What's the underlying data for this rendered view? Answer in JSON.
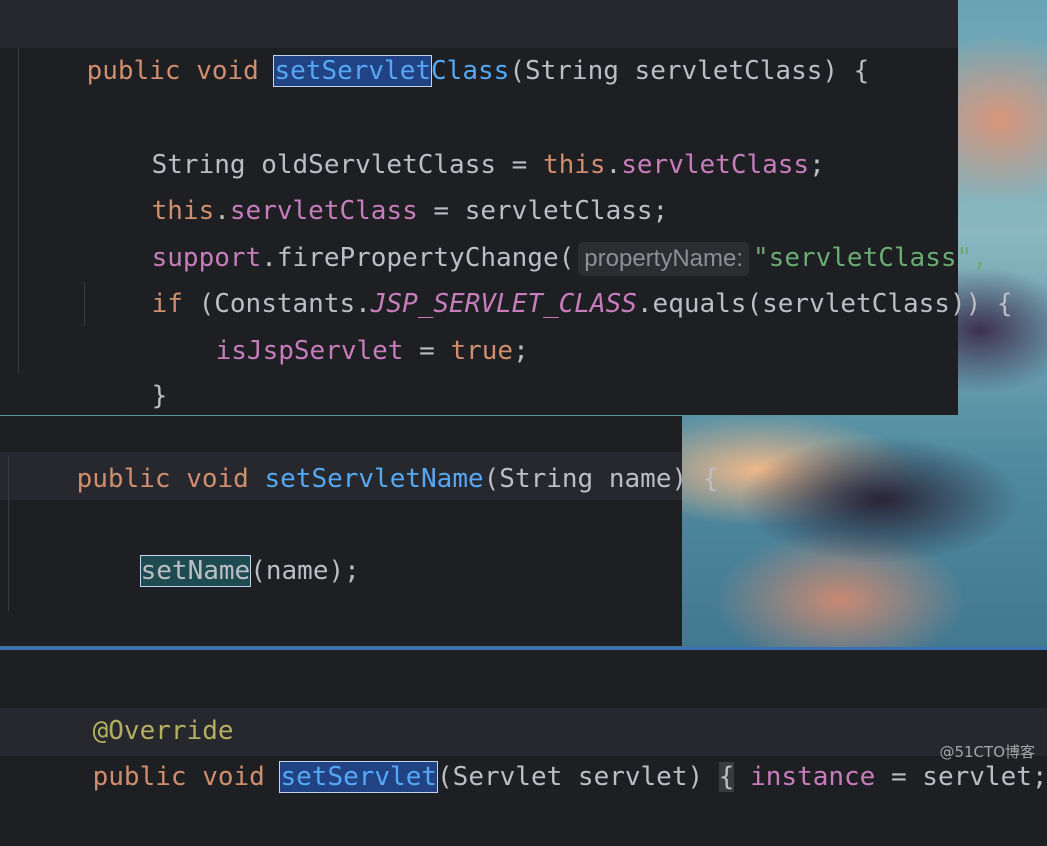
{
  "panel1": {
    "sig": {
      "kw1": "public",
      "kw2": "void",
      "name_sel": "setServlet",
      "name_rest": "Class",
      "params": "(String servletClass) {"
    },
    "l1": {
      "type": "String",
      "rest": " oldServletClass = ",
      "kw_this": "this",
      "dot": ".",
      "field": "servletClass",
      "end": ";"
    },
    "l2": {
      "kw_this": "this",
      "dot": ".",
      "field": "servletClass",
      "rest": " = servletClass;"
    },
    "l3": {
      "field": "support",
      "call": ".firePropertyChange(",
      "hint": "propertyName:",
      "str": "\"servletClass\","
    },
    "l4": {
      "kw_if": "if",
      "a": " (Constants.",
      "const": "JSP_SERVLET_CLASS",
      "b": ".equals(servletClass)) {"
    },
    "l5": {
      "field": "isJspServlet",
      "eq": " = ",
      "kw_true": "true",
      "end": ";"
    },
    "l6": "}",
    "l7": "}"
  },
  "panel2": {
    "sig": {
      "kw1": "public",
      "kw2": "void",
      "name": "setServletName",
      "params": "(String name) {"
    },
    "l2": {
      "call": "setName",
      "rest": "(name);"
    },
    "close": "}"
  },
  "panel3": {
    "annotation": "@Override",
    "sig": {
      "kw1": "public",
      "kw2": "void",
      "name_sel": "setServlet",
      "params": "(Servlet servlet)",
      "open": "{",
      "field": "instance",
      "rest": " = servlet;",
      "close": "}"
    }
  },
  "watermark": "@51CTO博客"
}
